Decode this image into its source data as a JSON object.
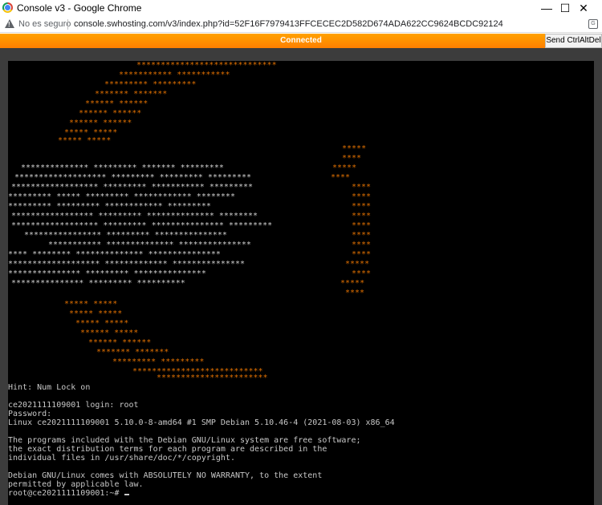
{
  "window": {
    "title": "Console v3 - Google Chrome",
    "controls": {
      "minimize": "—",
      "maximize": "☐",
      "close": "✕"
    }
  },
  "address_bar": {
    "security_label": "No es seguro",
    "url": "console.swhosting.com/v3/index.php?id=52F16F7979413FFCECEC2D582D674ADA622CC9624BCDC92124"
  },
  "status": {
    "text": "Connected",
    "send_button": "Send CtrlAltDel"
  },
  "colors": {
    "accent": "#ff8a00",
    "terminal_bg": "#000000",
    "logo_orange": "#e07000",
    "terminal_text": "#c8c8c8"
  },
  "icons": {
    "app": "chrome-icon",
    "warning": "warning-icon",
    "translate": "translate-icon"
  },
  "logo": {
    "orange_lines": [
      "*****************************",
      "***********            ***********",
      "*********                    *********",
      "*******                        *******",
      "******                            ******",
      "******                              ******",
      "******                                ******",
      "*****                                  *****",
      "*****                                    *****",
      "*****",
      "****",
      "*****",
      "****",
      "****",
      "****",
      "****",
      "****",
      "****",
      "****",
      "****",
      "****",
      "*****",
      "****",
      "*****",
      "****",
      "*****                                  *****",
      "*****                                 *****",
      "*****                              *****",
      "******                           *****",
      "******                        ******",
      "*******                    *******",
      "*********              *********",
      "***************************",
      "***********************"
    ],
    "white_lines": [
      "**************    *********        *******         *********",
      "******************* *********      *********       *********",
      "******************   *********    ***********     *********",
      "*********    *****  *********     ************    ********",
      "*********          *********     ************    *********",
      "*****************    *********  **************    ********",
      "******************  *********  ***************  *********",
      "  ****************   *********  ***************",
      "        ***********   **************  ***************",
      "****        ********    **************  ***************",
      "*******************    *************    ***************",
      "***************        *********       ***************",
      "  ***************        *********       **********"
    ]
  },
  "terminal": {
    "lines": [
      "Hint: Num Lock on",
      "",
      "ce2021111109001 login: root",
      "Password:",
      "Linux ce2021111109001 5.10.0-8-amd64 #1 SMP Debian 5.10.46-4 (2021-08-03) x86_64",
      "",
      "The programs included with the Debian GNU/Linux system are free software;",
      "the exact distribution terms for each program are described in the",
      "individual files in /usr/share/doc/*/copyright.",
      "",
      "Debian GNU/Linux comes with ABSOLUTELY NO WARRANTY, to the extent",
      "permitted by applicable law."
    ],
    "prompt": "root@ce2021111109001:~# "
  }
}
